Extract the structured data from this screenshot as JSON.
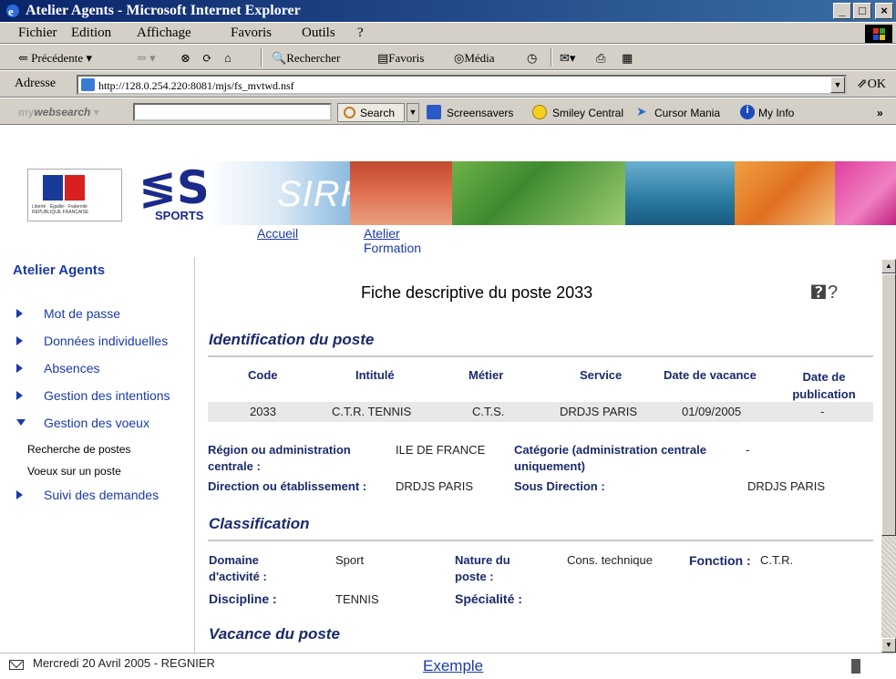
{
  "window": {
    "title": "Atelier Agents - Microsoft Internet Explorer"
  },
  "menu": [
    "Fichier",
    "Edition",
    "Affichage",
    "Favoris",
    "Outils",
    "?"
  ],
  "toolbar": {
    "back": "Précédente",
    "search": "Rechercher",
    "favorites": "Favoris",
    "media": "Média"
  },
  "address": {
    "label": "Adresse",
    "url": "http://128.0.254.220:8081/mjs/fs_mvtwd.nsf",
    "go": "OK"
  },
  "searchbar": {
    "brand_prefix": "my",
    "brand_main": "websearch",
    "search_label": "Search",
    "links": [
      "Screensavers",
      "Smiley Central",
      "Cursor Mania",
      "My Info"
    ]
  },
  "banner": {
    "sirhano": "SIRHANO",
    "sports": "SPORTS"
  },
  "nav": {
    "accueil": "Accueil",
    "atelier_line1": "Atelier",
    "atelier_line2": "Formation"
  },
  "sidebar": {
    "title": "Atelier Agents",
    "items": [
      "Mot de passe",
      "Données individuelles",
      "Absences",
      "Gestion des intentions",
      "Gestion des voeux"
    ],
    "subitems": [
      "Recherche de postes",
      "Voeux sur un poste"
    ],
    "last_item": "Suivi des demandes"
  },
  "main": {
    "title": "Fiche descriptive du poste 2033",
    "sections": {
      "identification": "Identification du poste",
      "classification": "Classification",
      "vacance": "Vacance du poste"
    },
    "table": {
      "headers": [
        "Code",
        "Intitulé",
        "Métier",
        "Service",
        "Date de vacance",
        "Date de",
        "publication"
      ],
      "row": [
        "2033",
        "C.T.R. TENNIS",
        "C.T.S.",
        "DRDJS PARIS",
        "01/09/2005",
        "-"
      ]
    },
    "fields": {
      "region_label_1": "Région ou administration",
      "region_label_2": "centrale :",
      "region_value": "ILE DE FRANCE",
      "categorie_label_1": "Catégorie (administration centrale",
      "categorie_label_2": "uniquement)",
      "categorie_value": "-",
      "direction_label": "Direction ou établissement :",
      "direction_value": "DRDJS PARIS",
      "sousdir_label": "Sous Direction :",
      "sousdir_value": "DRDJS PARIS",
      "domaine_label_1": "Domaine",
      "domaine_label_2": "d'activité :",
      "domaine_value": "Sport",
      "nature_label_1": "Nature du",
      "nature_label_2": "poste :",
      "nature_value": "Cons. technique",
      "fonction_label": "Fonction :",
      "fonction_value": "C.T.R.",
      "discipline_label": "Discipline :",
      "discipline_value": "TENNIS",
      "specialite_label": "Spécialité :"
    }
  },
  "status": {
    "message": "Mercredi 20 Avril 2005 - REGNIER",
    "link": "Exemple"
  },
  "colors": {
    "link": "#1a3aa8",
    "heading": "#1a2a6a",
    "titlebar": "#0a246a",
    "chrome": "#d4d0c8"
  }
}
